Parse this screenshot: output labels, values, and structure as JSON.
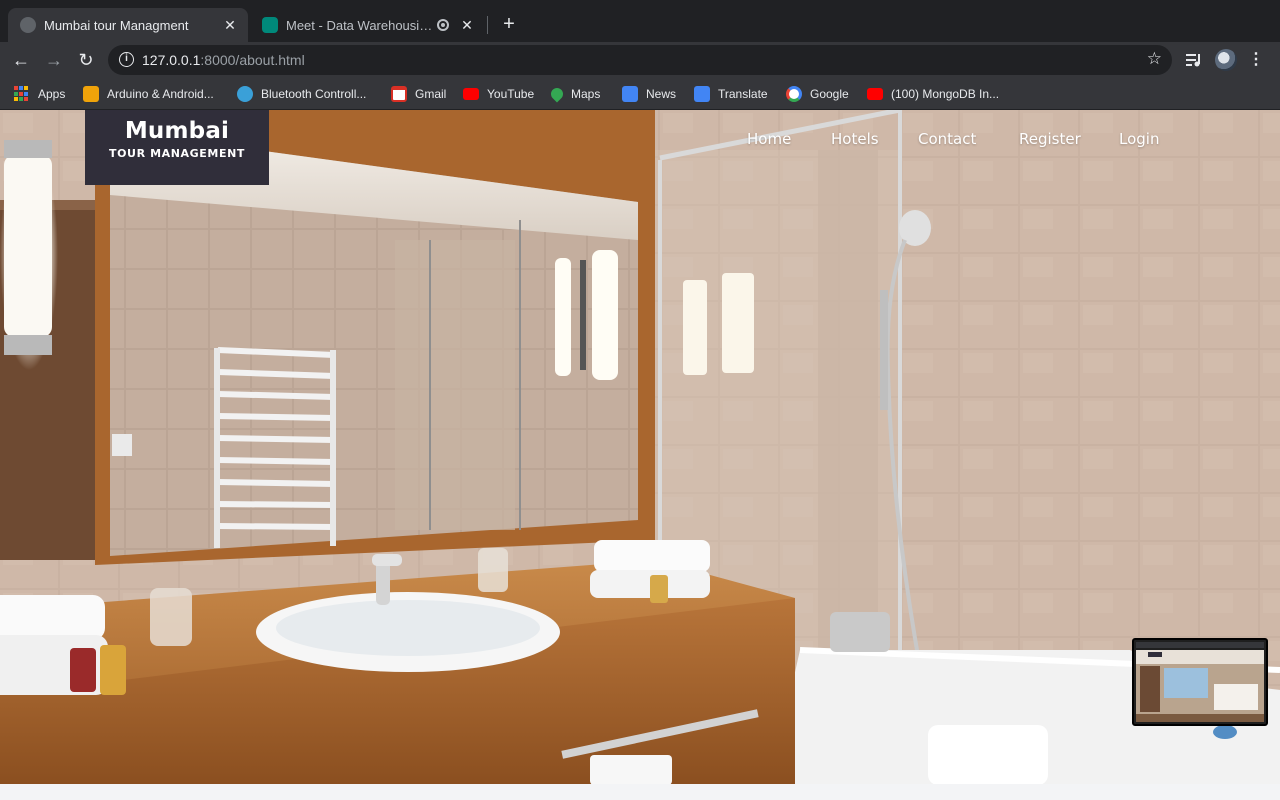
{
  "browser": {
    "tabs": [
      {
        "title": "Mumbai tour Managment",
        "active": true
      },
      {
        "title": "Meet - Data Warehousing and",
        "active": false
      }
    ],
    "url_host": "127.0.0.1",
    "url_path": ":8000/about.html",
    "bookmarks": [
      {
        "label": "Apps",
        "icon": "apps-grid-icon"
      },
      {
        "label": "Arduino & Android...",
        "icon": "arduino-icon"
      },
      {
        "label": "Bluetooth Controll...",
        "icon": "globe-icon"
      },
      {
        "label": "Gmail",
        "icon": "gmail-icon"
      },
      {
        "label": "YouTube",
        "icon": "youtube-icon"
      },
      {
        "label": "Maps",
        "icon": "maps-pin-icon"
      },
      {
        "label": "News",
        "icon": "news-icon"
      },
      {
        "label": "Translate",
        "icon": "translate-icon"
      },
      {
        "label": "Google",
        "icon": "google-icon"
      },
      {
        "label": "(100) MongoDB In...",
        "icon": "youtube-icon"
      }
    ]
  },
  "site": {
    "brand_name": "Mumbai",
    "brand_sub": "TOUR MANAGEMENT",
    "nav": [
      "Home",
      "Hotels",
      "Contact",
      "Register",
      "Login"
    ]
  },
  "colors": {
    "chrome_dark": "#202124",
    "chrome_toolbar": "#35363a",
    "brand_box": "#302e3a",
    "nav_text": "#ffffff"
  }
}
